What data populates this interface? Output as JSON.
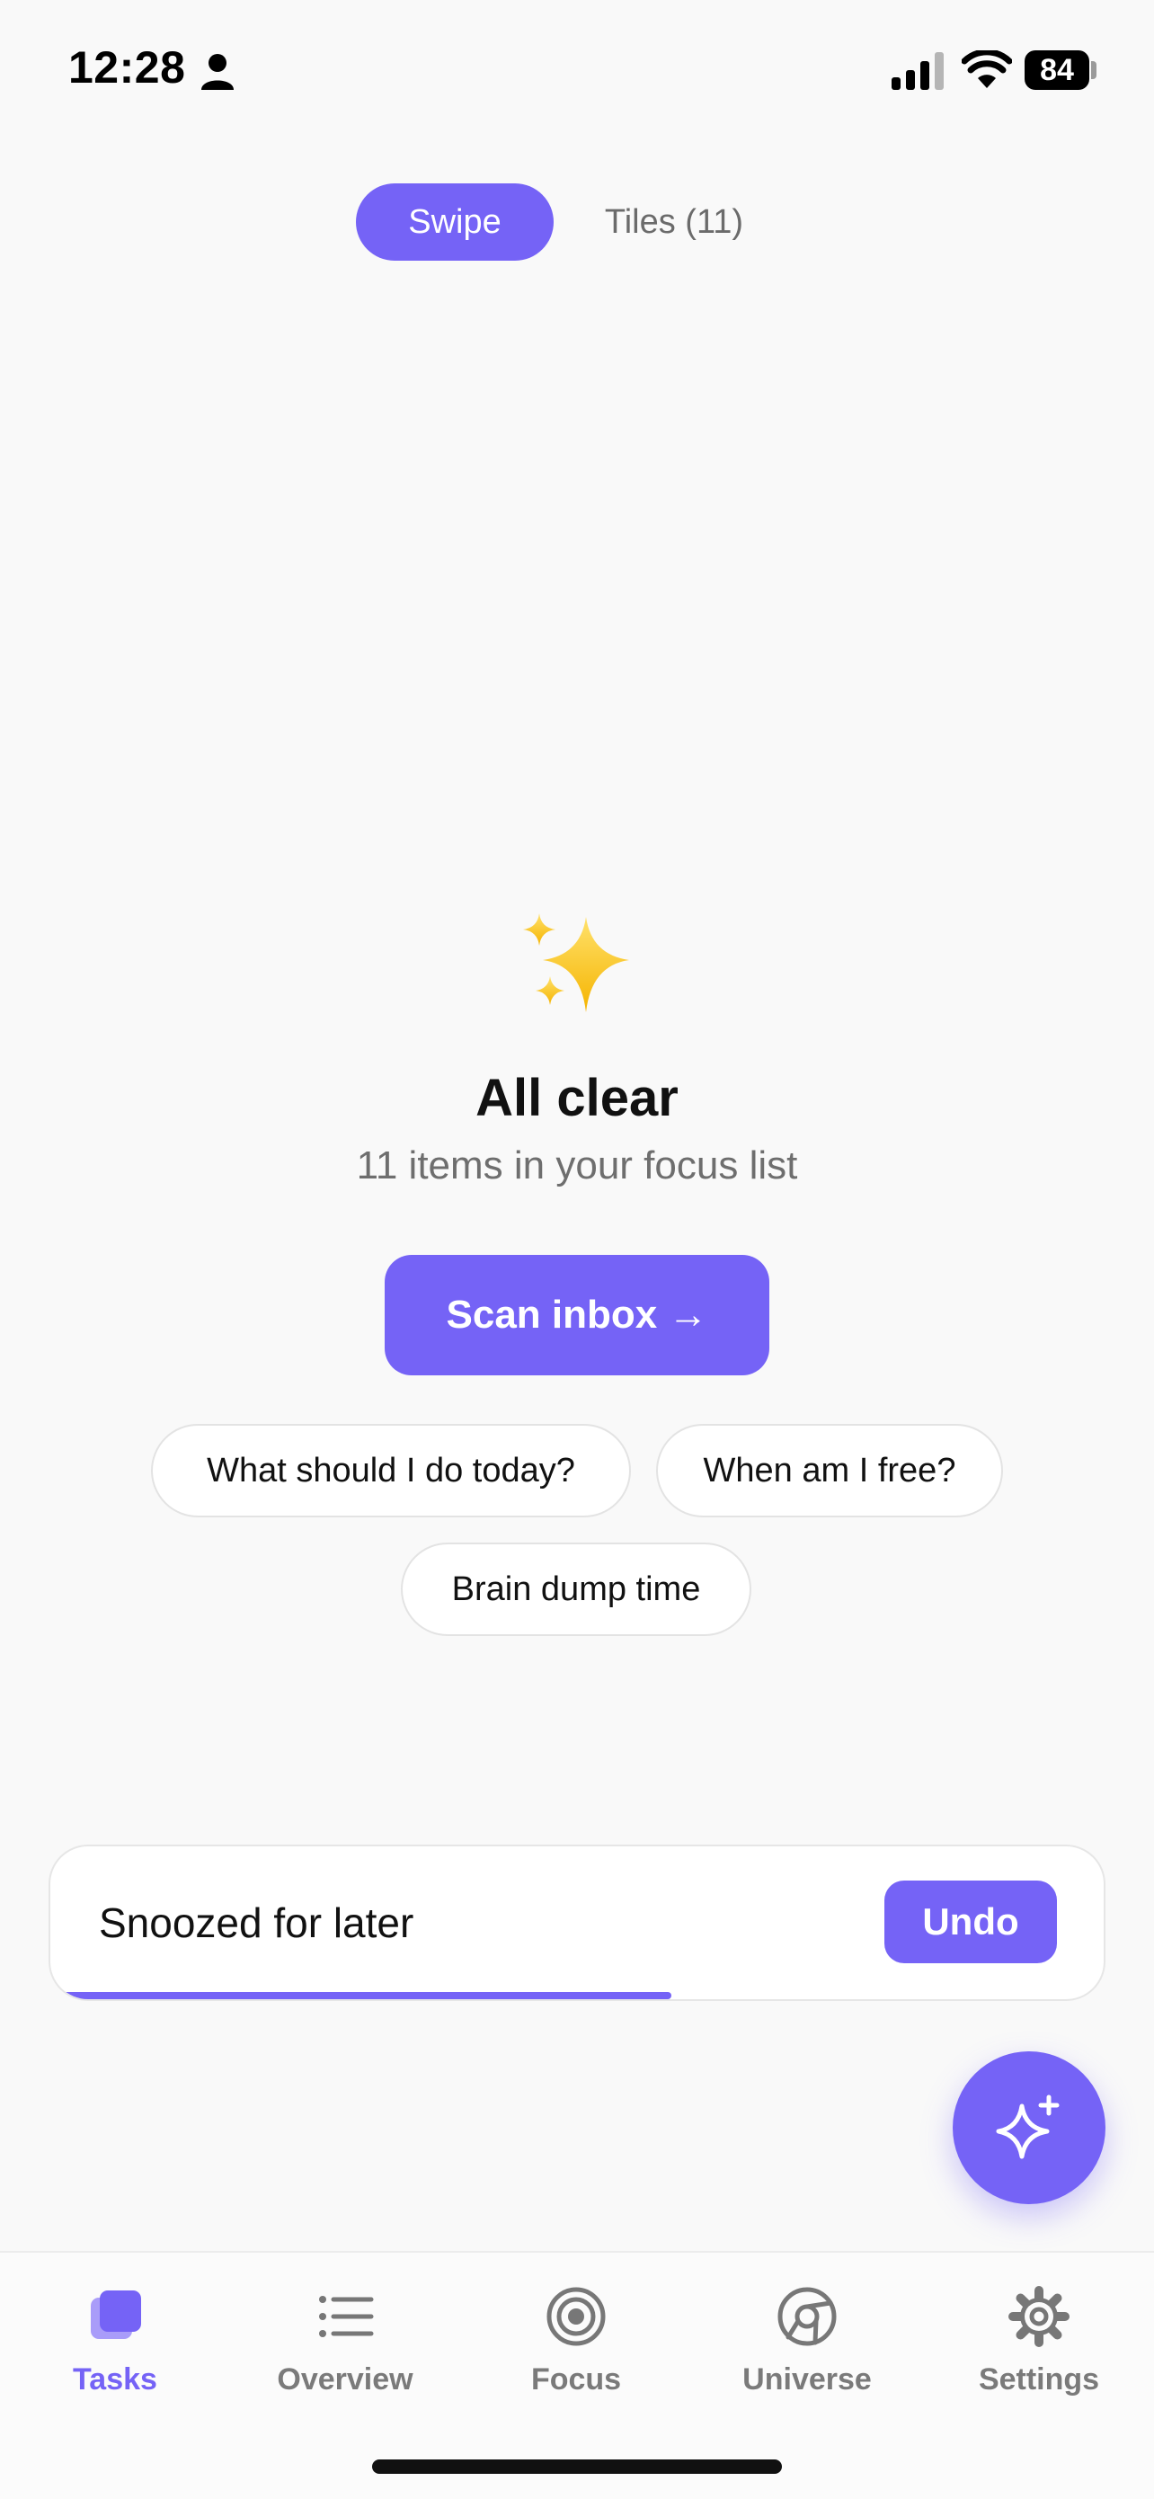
{
  "status_bar": {
    "time": "12:28",
    "battery": "84",
    "icons": [
      "person-icon",
      "signal-icon",
      "wifi-icon",
      "battery-icon"
    ]
  },
  "view_toggle": {
    "swipe_label": "Swipe",
    "tiles_label": "Tiles (11)",
    "selected": "Swipe"
  },
  "empty_state": {
    "icon": "sparkles-icon",
    "title": "All clear",
    "subtitle": "11 items in your focus list",
    "scan_button": "Scan inbox →"
  },
  "suggestions": [
    {
      "label": "What should I do today?"
    },
    {
      "label": "When am I free?"
    },
    {
      "label": "Brain dump time"
    }
  ],
  "snackbar": {
    "message": "Snoozed for later",
    "action": "Undo",
    "progress": 0.59
  },
  "fab": {
    "icon": "sparkle-plus-icon"
  },
  "tab_bar": {
    "items": [
      {
        "label": "Tasks",
        "icon": "tasks-icon",
        "active": true
      },
      {
        "label": "Overview",
        "icon": "list-icon",
        "active": false
      },
      {
        "label": "Focus",
        "icon": "target-icon",
        "active": false
      },
      {
        "label": "Universe",
        "icon": "universe-icon",
        "active": false
      },
      {
        "label": "Settings",
        "icon": "gear-icon",
        "active": false
      }
    ]
  },
  "colors": {
    "accent": "#7563f6",
    "background": "#f9f9f9",
    "muted_text": "#6e6e6e"
  }
}
